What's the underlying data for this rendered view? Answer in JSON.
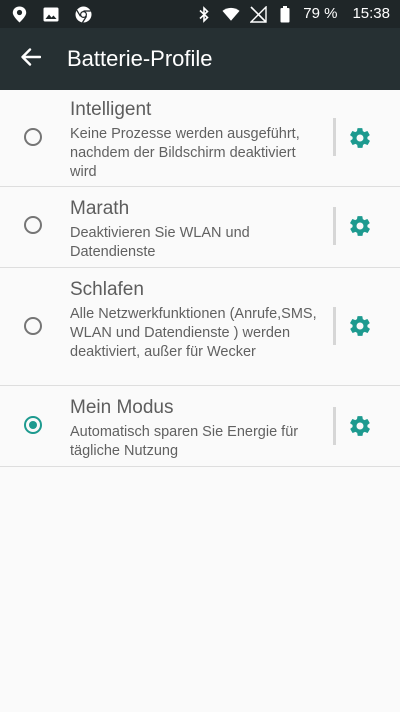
{
  "status_bar": {
    "icons_left": [
      "location-pin-icon",
      "image-icon",
      "chrome-icon"
    ],
    "icons_right": [
      "bluetooth-icon",
      "wifi-icon",
      "no-signal-icon",
      "battery-icon"
    ],
    "battery_percent": "79 %",
    "time": "15:38"
  },
  "app_bar": {
    "title": "Batterie-Profile",
    "back_icon": "arrow-left-icon"
  },
  "colors": {
    "app_bar": "#263033",
    "status_bar": "#1f2628",
    "accent": "#1d9a8f",
    "background": "#fafafa"
  },
  "profiles": [
    {
      "title": "Intelligent",
      "description": "Keine Prozesse werden ausgeführt, nachdem der Bildschirm deaktiviert wird",
      "selected": false
    },
    {
      "title": "Marath",
      "description": "Deaktivieren Sie WLAN und Datendienste",
      "selected": false
    },
    {
      "title": "Schlafen",
      "description": "Alle Netzwerkfunktionen (Anrufe,SMS, WLAN und Datendienste ) werden deaktiviert, außer für Wecker",
      "selected": false
    },
    {
      "title": "Mein Modus",
      "description": "Automatisch sparen Sie Energie für tägliche Nutzung",
      "selected": true
    }
  ]
}
